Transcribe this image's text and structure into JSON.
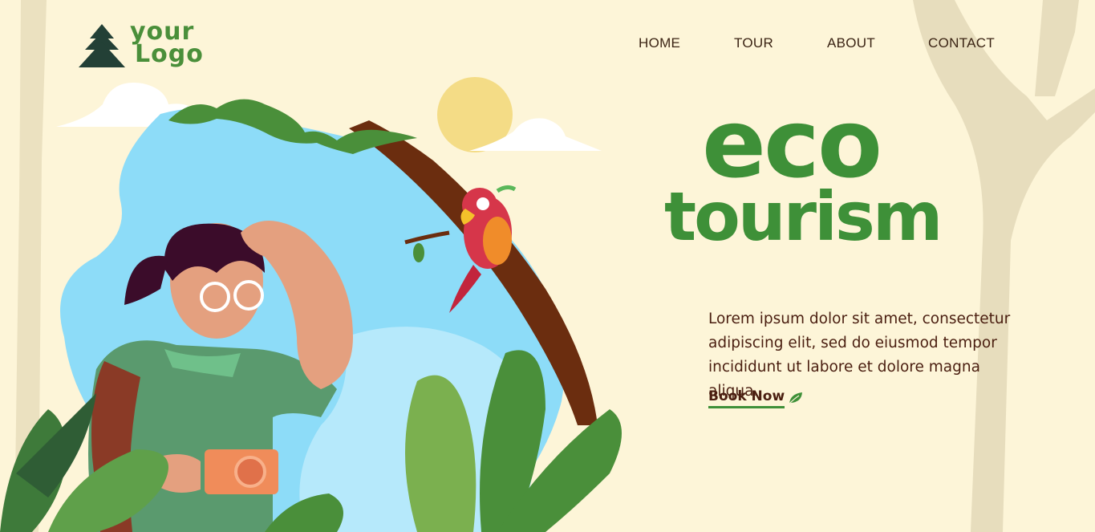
{
  "logo": {
    "line1": "your",
    "line2": "Logo"
  },
  "nav": [
    {
      "label": "HOME"
    },
    {
      "label": "TOUR"
    },
    {
      "label": "ABOUT"
    },
    {
      "label": "CONTACT"
    }
  ],
  "hero": {
    "title_line1": "eco",
    "title_line2": "tourism",
    "description": "Lorem ipsum dolor sit amet, consectetur adipiscing elit, sed do eiusmod tempor incididunt ut labore et dolore magna aliqua.",
    "cta_label": "Book Now"
  },
  "colors": {
    "background": "#fdf5d8",
    "accent_green": "#3e9038",
    "text_brown": "#4a1e10",
    "sky_blue": "#8ddcf8"
  },
  "icons": [
    "pine-tree-icon",
    "leaf-icon"
  ]
}
